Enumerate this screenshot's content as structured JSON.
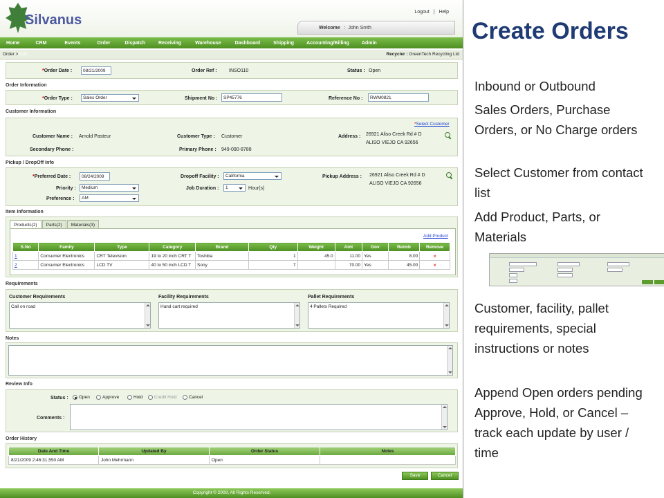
{
  "app": {
    "logo_text": "Silvanus",
    "top_links": [
      "Logout",
      "|",
      "Help"
    ],
    "welcome_label": "Welcome",
    "welcome_sep": ":",
    "welcome_user": "John Smth"
  },
  "nav": [
    "Home",
    "CRM",
    "Events",
    "Order",
    "Dispatch",
    "Receiving",
    "Warehouse",
    "Dashboard",
    "Shipping",
    "Accounting/Billing",
    "Admin"
  ],
  "breadcrumb": {
    "root": "Order",
    "sep": ">",
    "current": "Edit",
    "recycler_label": "Recycler :",
    "recycler": "GreenTech Recycling Ltd"
  },
  "order_header": {
    "order_date_label": "Order Date :",
    "order_date": "08/21/2009",
    "order_ref_label": "Order Ref :",
    "order_ref": "INSO110",
    "status_label": "Status :",
    "status": "Open"
  },
  "order_info": {
    "title": "Order Information",
    "type_label": "Order Type :",
    "type": "Sales Order",
    "shipment_label": "Shipment No :",
    "shipment": "SP45776",
    "reference_label": "Reference No :",
    "reference": "RWM0821"
  },
  "customer": {
    "title": "Customer Information",
    "select_link": "Select Customer",
    "name_label": "Customer Name :",
    "name": "Arnold Pasteur",
    "type_label": "Customer Type :",
    "type": "Customer",
    "address_label": "Address :",
    "address1": "26921 Aliso Creek Rd # D",
    "address2": "ALISO VIEJO CA 92656",
    "secondary_label": "Secondary Phone :",
    "primary_label": "Primary Phone :",
    "primary": "949-090-8788"
  },
  "pickup": {
    "title": "Pickup / DropOff Info",
    "date_label": "Preferred Date :",
    "date": "08/24/2009",
    "facility_label": "Dropoff Facility :",
    "facility": "California",
    "address_label": "Pickup Address :",
    "address1": "26921 Aliso Creek Rd # D",
    "address2": "ALISO VIEJO CA 92656",
    "priority_label": "Priority :",
    "priority": "Medium",
    "duration_label": "Job Duration :",
    "duration": "1",
    "duration_unit": "Hour(s)",
    "preference_label": "Preference :",
    "preference": "AM"
  },
  "items": {
    "title": "Item Information",
    "tabs": [
      "Products(2)",
      "Parts(2)",
      "Materials(3)"
    ],
    "add_link": "Add Product",
    "columns": [
      "S.No",
      "Family",
      "Type",
      "Category",
      "Brand",
      "Qty",
      "Weight",
      "Amt",
      "Gov",
      "Reimb",
      "Remove"
    ],
    "rows": [
      {
        "sno": "1",
        "family": "Consumer Electronics",
        "type": "CRT Television",
        "category": "19 to 20 inch CRT T",
        "brand": "Toshiba",
        "qty": "1",
        "weight": "45.0",
        "amt": "11.00",
        "gov": "Yes",
        "reimb": "8.00",
        "remove": "×"
      },
      {
        "sno": "2",
        "family": "Consumer Electronics",
        "type": "LCD TV",
        "category": "40 to 50 inch LCD T",
        "brand": "Sony",
        "qty": "7",
        "weight": "",
        "amt": "70.00",
        "gov": "Yes",
        "reimb": "45.00",
        "remove": "×"
      }
    ]
  },
  "requirements": {
    "title": "Requirements",
    "customer_label": "Customer Requirements",
    "customer": "Call on road",
    "facility_label": "Facility Requirements",
    "facility": "Hand cart required",
    "pallet_label": "Pallet Requirements",
    "pallet": "4 Pallets Required"
  },
  "notes": {
    "title": "Notes",
    "value": ""
  },
  "review": {
    "title": "Review Info",
    "status_label": "Status :",
    "options": [
      "Open",
      "Approve",
      "Hold",
      "Credit Hold",
      "Cancel"
    ],
    "comments_label": "Comments :"
  },
  "history": {
    "title": "Order History",
    "columns": [
      "Date And Time",
      "Updated By",
      "Order Status",
      "Notes"
    ],
    "rows": [
      {
        "date": "8/21/2009 2:46:31,550 AM",
        "by": "John Mehrmann",
        "status": "Open",
        "notes": ""
      }
    ]
  },
  "buttons": {
    "save": "Save",
    "cancel": "Cancel"
  },
  "footer": "Copyright © 2009, All Rights Reserved.",
  "slide": {
    "title": "Create Orders",
    "bullets": [
      "Inbound or Outbound",
      "Sales Orders, Purchase Orders, or No Charge orders",
      "Select Customer from contact list",
      "Add Product, Parts, or Materials",
      "Customer, facility, pallet requirements, special instructions or notes",
      "Append Open orders pending Approve, Hold, or Cancel – track each update by user / time"
    ]
  },
  "colors": {
    "nav_green": "#5fa02f",
    "title_blue": "#1f3b73",
    "link_blue": "#1a3fd6",
    "panel": "#eef4e6",
    "remove_red": "#dd0000"
  }
}
